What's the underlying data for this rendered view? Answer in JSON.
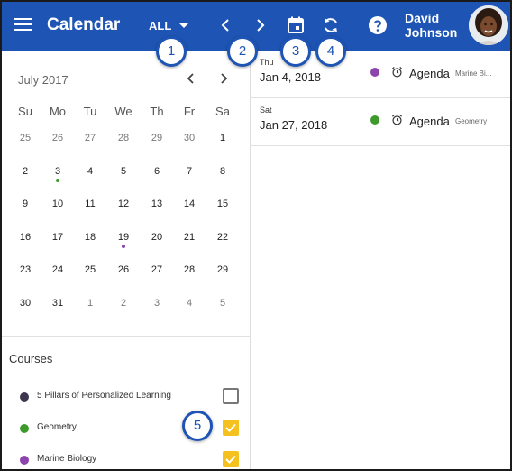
{
  "header": {
    "title": "Calendar",
    "filter_label": "ALL",
    "user_first": "David",
    "user_last": "Johnson",
    "color": "#1e55b5"
  },
  "callouts": [
    "1",
    "2",
    "3",
    "4",
    "5"
  ],
  "mini_calendar": {
    "month_label": "July 2017",
    "weekdays": [
      "Su",
      "Mo",
      "Tu",
      "We",
      "Th",
      "Fr",
      "Sa"
    ],
    "weeks": [
      [
        "25",
        "26",
        "27",
        "28",
        "29",
        "30",
        "1"
      ],
      [
        "2",
        "3",
        "4",
        "5",
        "6",
        "7",
        "8"
      ],
      [
        "9",
        "10",
        "11",
        "12",
        "13",
        "14",
        "15"
      ],
      [
        "16",
        "17",
        "18",
        "19",
        "20",
        "21",
        "22"
      ],
      [
        "23",
        "24",
        "25",
        "26",
        "27",
        "28",
        "29"
      ],
      [
        "30",
        "31",
        "1",
        "2",
        "3",
        "4",
        "5"
      ]
    ]
  },
  "courses": {
    "title": "Courses",
    "items": [
      {
        "name": "5 Pillars of Personalized Learning",
        "color": "#3e3550",
        "checked": false
      },
      {
        "name": "Geometry",
        "color": "#3e9a2b",
        "checked": true
      },
      {
        "name": "Marine Biology",
        "color": "#8e44ad",
        "checked": true
      }
    ]
  },
  "agenda": [
    {
      "dow": "Thu",
      "date": "Jan 4, 2018",
      "type": "Agenda",
      "course": "Marine Bi...",
      "color": "#8e44ad"
    },
    {
      "dow": "Sat",
      "date": "Jan 27, 2018",
      "type": "Agenda",
      "course": "Geometry",
      "color": "#3e9a2b"
    }
  ]
}
